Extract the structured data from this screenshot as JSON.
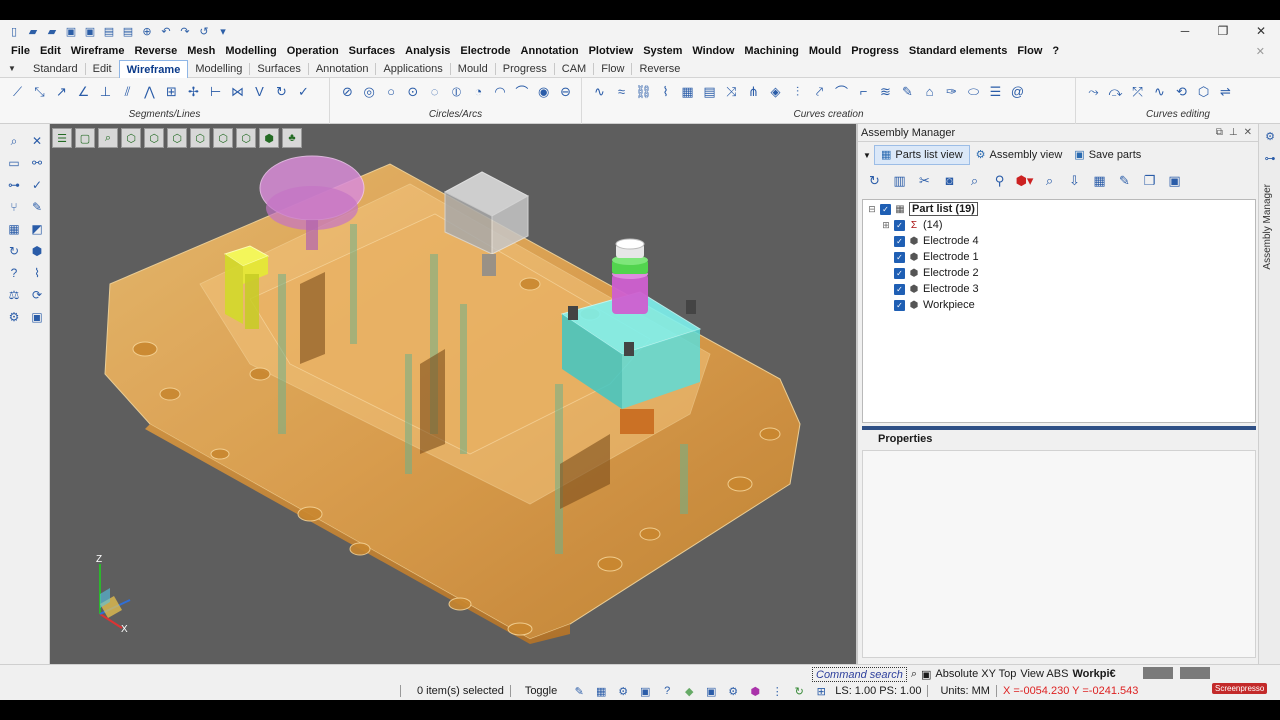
{
  "menu": [
    "File",
    "Edit",
    "Wireframe",
    "Reverse",
    "Mesh",
    "Modelling",
    "Operation",
    "Surfaces",
    "Analysis",
    "Electrode",
    "Annotation",
    "Plotview",
    "System",
    "Window",
    "Machining",
    "Mould",
    "Progress",
    "Standard elements",
    "Flow",
    "?"
  ],
  "menu_close": "✕",
  "tabs": [
    "Standard",
    "Edit",
    "Wireframe",
    "Modelling",
    "Surfaces",
    "Annotation",
    "Applications",
    "Mould",
    "Progress",
    "CAM",
    "Flow",
    "Reverse"
  ],
  "active_tab": "Wireframe",
  "ribbon_groups": {
    "segments": "Segments/Lines",
    "circles": "Circles/Arcs",
    "curves_creation": "Curves creation",
    "curves_editing": "Curves editing"
  },
  "assembly": {
    "title": "Assembly Manager",
    "tabs": {
      "parts_list": "Parts list view",
      "assembly_view": "Assembly view",
      "save_parts": "Save parts"
    },
    "tree": {
      "root": "Part list (19)",
      "sum": "(14)",
      "items": [
        "Electrode 4",
        "Electrode 1",
        "Electrode 2",
        "Electrode 3",
        "Workpiece"
      ]
    },
    "properties_title": "Properties",
    "side_label": "Assembly Manager"
  },
  "viewport": {
    "axis_z": "Z",
    "axis_x": "X",
    "colors": {
      "background": "#5e5e5e",
      "part": "#e9a94e",
      "electrode_cyan": "#5fe3e0",
      "electrode_pink": "#d98cd8",
      "electrode_yellow": "#e8ef3a",
      "electrode_grey": "#c9c9c9"
    }
  },
  "status": {
    "command_search": "Command search",
    "view_mode": "Absolute XY Top",
    "view_abs": "View ABS",
    "workpiece_short": "Workpi€",
    "selection": "0 item(s) selected",
    "toggle": "Toggle",
    "ls_ps": "LS: 1.00 PS: 1.00",
    "units": "Units: MM",
    "coords": "X =-0054.230 Y =-0241.543"
  },
  "watermark": "Screenpresso"
}
